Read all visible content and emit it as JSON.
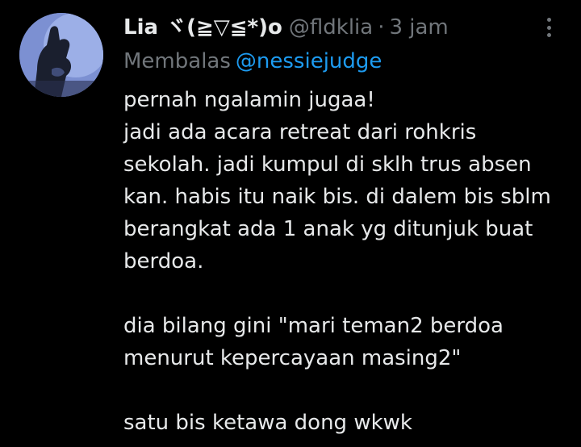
{
  "tweet": {
    "display_name": "Lia ヾ(≧▽≦*)o",
    "handle": "@fldklia",
    "separator": "·",
    "time": "3 jam",
    "more_icon": "more-dots-vertical-icon",
    "reply": {
      "prefix": "Membalas",
      "mention": "@nessiejudge"
    },
    "lines": [
      "pernah ngalamin jugaa!",
      "jadi ada acara retreat dari rohkris",
      "sekolah. jadi kumpul di sklh trus absen",
      "kan. habis itu naik bis. di dalem bis sblm",
      "berangkat ada 1 anak yg ditunjuk buat",
      "berdoa.",
      "",
      "dia bilang gini \"mari teman2 berdoa",
      "menurut kepercayaan masing2\"",
      "",
      "satu bis ketawa dong wkwk"
    ]
  },
  "colors": {
    "background": "#000000",
    "primary_text": "#e7e9ea",
    "secondary_text": "#71767b",
    "link": "#1d9bf0"
  }
}
